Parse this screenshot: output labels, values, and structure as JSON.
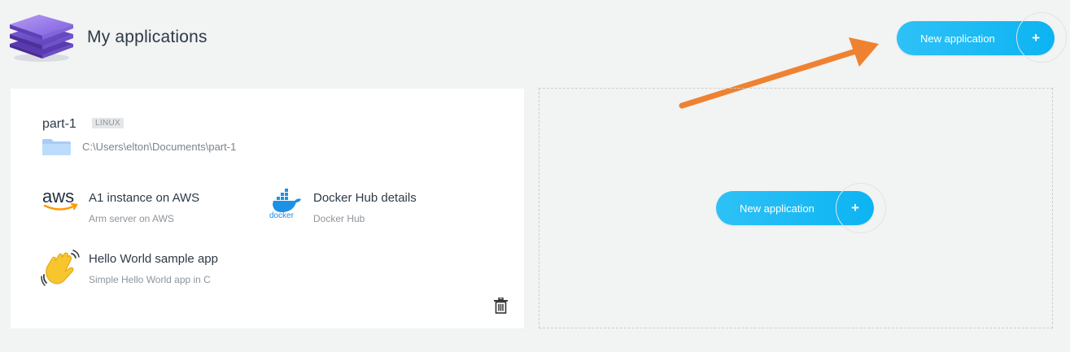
{
  "header": {
    "title": "My applications",
    "new_button_label": "New application",
    "plus_symbol": "+"
  },
  "app_card": {
    "name": "part-1",
    "os_badge": "LINUX",
    "path": "C:\\Users\\elton\\Documents\\part-1",
    "services": [
      {
        "title": "A1 instance on AWS",
        "subtitle": "Arm server on AWS",
        "icon": "aws-logo-icon"
      },
      {
        "title": "Docker Hub details",
        "subtitle": "Docker Hub",
        "icon": "docker-logo-icon"
      },
      {
        "title": "Hello World sample app",
        "subtitle": "Simple Hello World app in C",
        "icon": "waving-hand-icon"
      }
    ],
    "aws_logo_text": "aws",
    "docker_logo_text": "docker",
    "delete_icon": "trash-icon"
  },
  "dropzone": {
    "new_button_label": "New application",
    "plus_symbol": "+"
  },
  "colors": {
    "accent": "#0cb4f2",
    "arrow": "#ee8231",
    "background": "#f2f3f3",
    "card": "#ffffff"
  }
}
